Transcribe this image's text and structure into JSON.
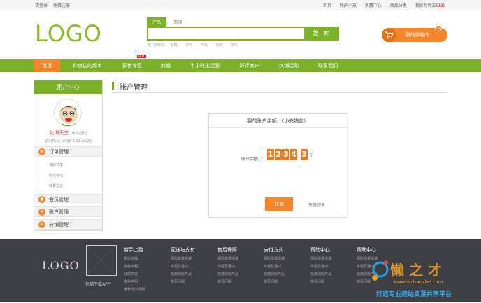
{
  "topbar": {
    "login": "请登录",
    "register": "免费注册",
    "links": [
      "首页",
      "我的小充",
      "消费中心",
      "商品分类"
    ],
    "cart_label": "我的购物车",
    "cart_count": "(23)"
  },
  "header": {
    "logo": "LOGO",
    "search_tabs": [
      "产品",
      "店铺"
    ],
    "search_button": "搜 索",
    "hot_label": "热门搜索词：",
    "hot_words": [
      "首糕",
      "茶叶",
      "咔咕",
      "香菇",
      "茶叶"
    ],
    "cart_button": "我的购物车",
    "cart_badge": "0"
  },
  "nav": {
    "items": [
      "首页",
      "你身边的超市",
      "预售专区",
      "商城",
      "半小时生活圈",
      "好评商户",
      "热销活动",
      "联系我们"
    ],
    "hot_badge": "HOT"
  },
  "sidebar": {
    "title": "用户中心",
    "username": "化海天堂",
    "edit_password": "[修改密码]",
    "login_time": "访问时间：2016-1-21 10:23",
    "order_section": "订单管理",
    "order_items": [
      "我的订单",
      "收货地址",
      "缺货登记"
    ],
    "sections": [
      "会员管理",
      "账户管理",
      "分销管理"
    ]
  },
  "main": {
    "title": "账户管理",
    "panel_title": "我的账户余额：（小充钱包）",
    "balance_label": "账户余额：",
    "balance_digits": [
      "1",
      "2",
      "3",
      "4"
    ],
    "balance_decimal": "3",
    "balance_dot": ".",
    "balance_unit": "元",
    "recharge_button": "充值",
    "recharge_record": "充值记录"
  },
  "footer": {
    "logo": "LOGO",
    "qr_label": "扫描下载APP",
    "columns": [
      {
        "title": "新手上路",
        "links": [
          "售后流程",
          "购物流程",
          "订购方式",
          "隐私声明",
          "推荐分享说明"
        ]
      },
      {
        "title": "配送与支付",
        "links": [
          "保险需求测试",
          "专题及活动",
          "挑选保险产品",
          "常见问题"
        ]
      },
      {
        "title": "售后保障",
        "links": [
          "保险需求测试",
          "专题及活动",
          "挑选保险产品",
          "常见问题"
        ]
      },
      {
        "title": "支付方式",
        "links": [
          "保险需求测试",
          "专题及活动",
          "挑选保险产品",
          "常见问题"
        ]
      },
      {
        "title": "帮助中心",
        "links": [
          "保险需求测试",
          "专题及活动",
          "挑选保险产品",
          "常见问题"
        ]
      },
      {
        "title": "帮助中心",
        "links": [
          "保险需求测试",
          "专题及活动",
          "挑选保险产品",
          "常见问题"
        ]
      }
    ],
    "watermark_chars": "懒 之 才",
    "watermark_url": "www.aizhanzhe.com",
    "watermark_slogan": "打造专业建站资源共享平台"
  },
  "colors": {
    "green": "#7cb228",
    "orange": "#f7862b",
    "footer": "#3e3e45"
  }
}
